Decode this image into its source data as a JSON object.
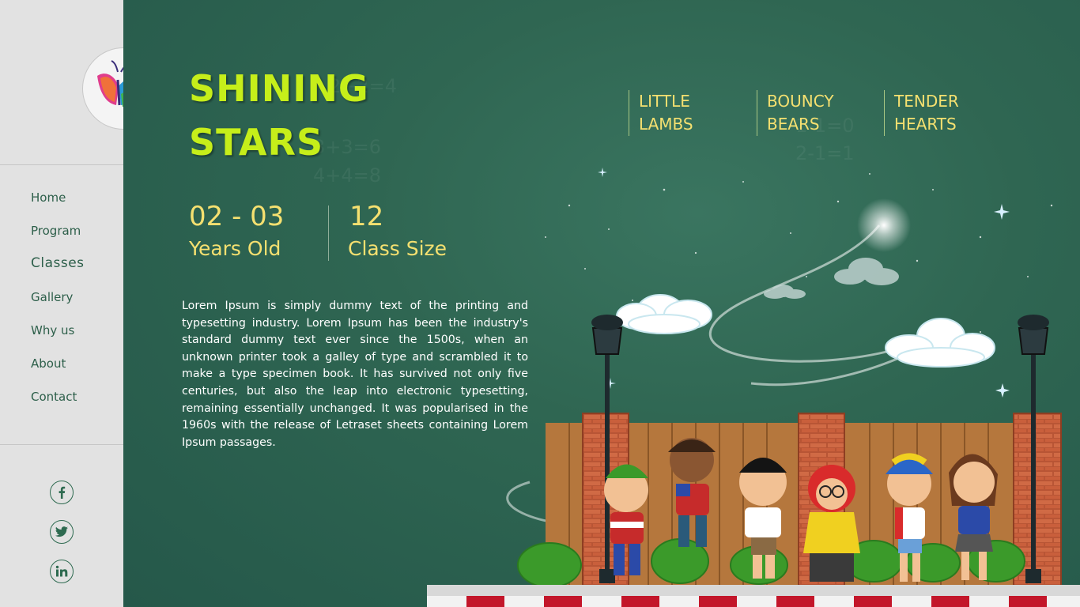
{
  "brand": {
    "title_line1": "SHINING",
    "title_line2": "STARS"
  },
  "sidebar": {
    "nav": [
      {
        "label": "Home"
      },
      {
        "label": "Program"
      },
      {
        "label": "Classes",
        "active": true
      },
      {
        "label": "Gallery"
      },
      {
        "label": "Why us"
      },
      {
        "label": "About"
      },
      {
        "label": "Contact"
      }
    ],
    "social": [
      {
        "icon": "facebook-icon",
        "glyph": "f"
      },
      {
        "icon": "twitter-icon",
        "glyph": "t"
      },
      {
        "icon": "linkedin-icon",
        "glyph": "in"
      }
    ]
  },
  "stats": {
    "age_value": "02 - 03",
    "age_label": "Years Old",
    "size_value": "12",
    "size_label": "Class Size"
  },
  "description": "Lorem Ipsum is simply dummy text of the printing and typesetting industry. Lorem Ipsum has been the industry's standard dummy text ever since the 1500s, when an unknown printer took a galley of type and scrambled it to make a type specimen book. It has survived not only five centuries, but also the leap into electronic typesetting, remaining essentially unchanged. It was popularised in the 1960s with the release of Letraset sheets containing Lorem Ipsum passages.",
  "classes": [
    {
      "line1": "LITTLE",
      "line2": "LAMBS"
    },
    {
      "line1": "BOUNCY",
      "line2": "BEARS"
    },
    {
      "line1": "TENDER",
      "line2": "HEARTS"
    }
  ],
  "colors": {
    "sidebar_bg": "#e2e2e2",
    "board_green": "#2f6652",
    "title_lime": "#c6ee1a",
    "accent_yellow": "#f5e070",
    "nav_text": "#2d5f4a"
  }
}
